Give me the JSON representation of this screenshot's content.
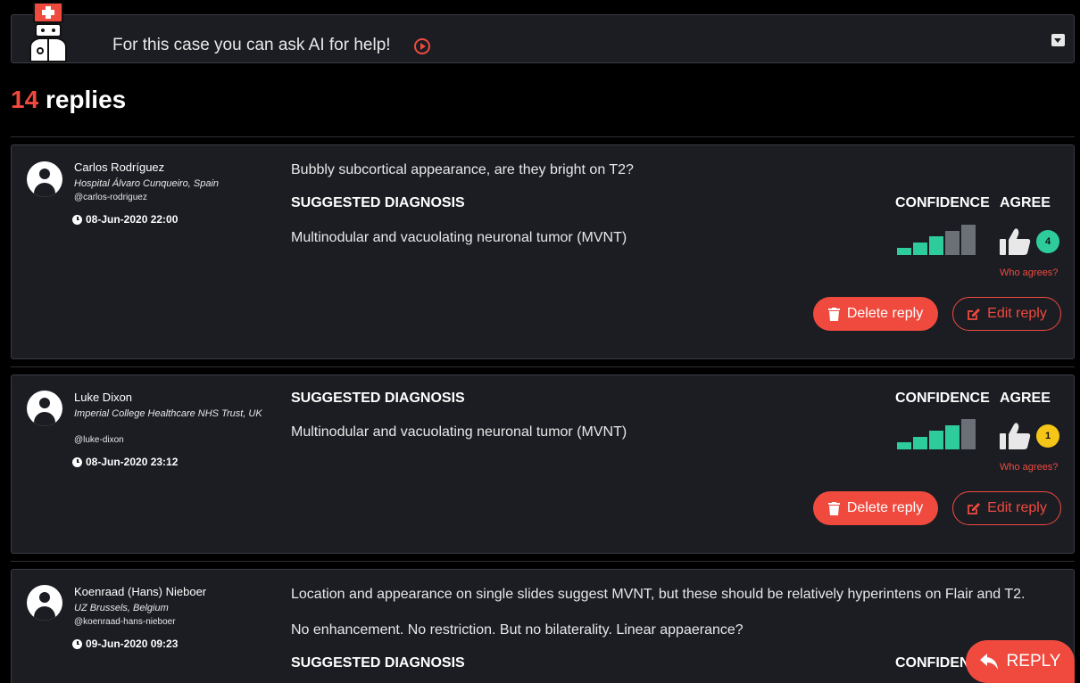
{
  "ai_banner": {
    "text": "For this case you can ask AI for help!",
    "icon": "doctor-icon"
  },
  "replies_heading": {
    "count": "14",
    "label": "replies"
  },
  "replies": [
    {
      "author": "Carlos Rodríguez",
      "hospital": "Hospital Álvaro Cunqueiro, Spain",
      "handle": "@carlos-rodriguez",
      "timestamp": "08-Jun-2020 22:00",
      "comments": [
        "Bubbly subcortical appearance, are they bright on T2?"
      ],
      "suggested_label": "SUGGESTED DIAGNOSIS",
      "diagnosis": "Multinodular and vacuolating neuronal tumor (MVNT)",
      "confidence_label": "CONFIDENCE",
      "confidence_level": 3,
      "confidence_max": 5,
      "agree_label": "AGREE",
      "agree_count": "4",
      "agree_badge_color": "#2ecc9a",
      "who_agrees": "Who agrees?",
      "delete_label": "Delete reply",
      "edit_label": "Edit reply"
    },
    {
      "author": "Luke Dixon",
      "hospital": "Imperial College Healthcare NHS Trust, UK",
      "handle": "@luke-dixon",
      "timestamp": "08-Jun-2020 23:12",
      "comments": [],
      "suggested_label": "SUGGESTED DIAGNOSIS",
      "diagnosis": "Multinodular and vacuolating neuronal tumor (MVNT)",
      "confidence_label": "CONFIDENCE",
      "confidence_level": 4,
      "confidence_max": 5,
      "agree_label": "AGREE",
      "agree_count": "1",
      "agree_badge_color": "#f5c518",
      "who_agrees": "Who agrees?",
      "delete_label": "Delete reply",
      "edit_label": "Edit reply"
    },
    {
      "author": "Koenraad (Hans) Nieboer",
      "hospital": "UZ Brussels, Belgium",
      "handle": "@koenraad-hans-nieboer",
      "timestamp": "09-Jun-2020 09:23",
      "comments": [
        "Location and appearance on single slides suggest MVNT, but these should be relatively hyperintens on Flair and T2.",
        "No enhancement. No restriction. But no bilaterality. Linear appaerance?"
      ],
      "suggested_label": "SUGGESTED DIAGNOSIS",
      "confidence_label": "CONFIDENCE"
    }
  ],
  "reply_button": "REPLY",
  "colors": {
    "accent": "#f04a3e",
    "confidence_active": "#2ecc9a",
    "confidence_inactive": "#6b7078",
    "card_bg": "#1b1d23"
  }
}
